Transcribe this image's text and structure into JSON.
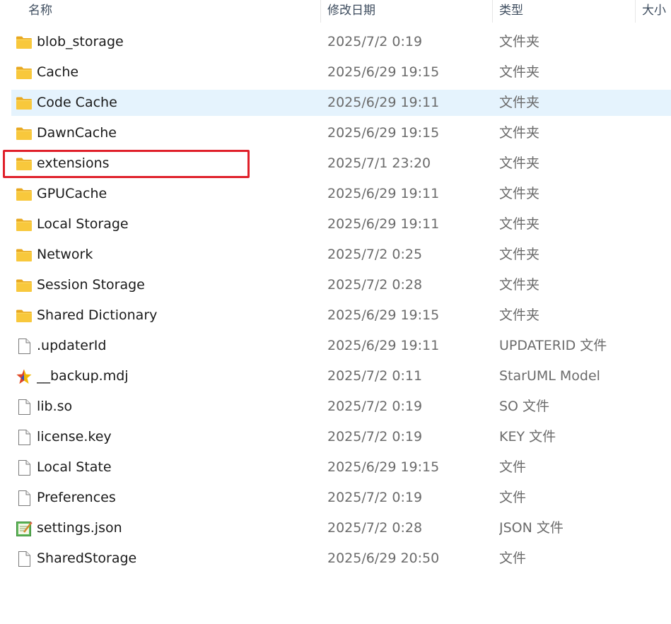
{
  "columns": {
    "name": "名称",
    "date": "修改日期",
    "type": "类型",
    "size": "大小"
  },
  "files": [
    {
      "name": "blob_storage",
      "date": "2025/7/2 0:19",
      "type": "文件夹",
      "icon": "folder-icon"
    },
    {
      "name": "Cache",
      "date": "2025/6/29 19:15",
      "type": "文件夹",
      "icon": "folder-icon"
    },
    {
      "name": "Code Cache",
      "date": "2025/6/29 19:11",
      "type": "文件夹",
      "icon": "folder-icon",
      "hovered": true
    },
    {
      "name": "DawnCache",
      "date": "2025/6/29 19:15",
      "type": "文件夹",
      "icon": "folder-icon"
    },
    {
      "name": "extensions",
      "date": "2025/7/1 23:20",
      "type": "文件夹",
      "icon": "folder-icon",
      "highlighted": true
    },
    {
      "name": "GPUCache",
      "date": "2025/6/29 19:11",
      "type": "文件夹",
      "icon": "folder-icon"
    },
    {
      "name": "Local Storage",
      "date": "2025/6/29 19:11",
      "type": "文件夹",
      "icon": "folder-icon"
    },
    {
      "name": "Network",
      "date": "2025/7/2 0:25",
      "type": "文件夹",
      "icon": "folder-icon"
    },
    {
      "name": "Session Storage",
      "date": "2025/7/2 0:28",
      "type": "文件夹",
      "icon": "folder-icon"
    },
    {
      "name": "Shared Dictionary",
      "date": "2025/6/29 19:15",
      "type": "文件夹",
      "icon": "folder-icon"
    },
    {
      "name": ".updaterId",
      "date": "2025/6/29 19:11",
      "type": "UPDATERID 文件",
      "icon": "file-icon"
    },
    {
      "name": "__backup.mdj",
      "date": "2025/7/2 0:11",
      "type": "StarUML Model",
      "icon": "staruml-icon"
    },
    {
      "name": "lib.so",
      "date": "2025/7/2 0:19",
      "type": "SO 文件",
      "icon": "file-icon"
    },
    {
      "name": "license.key",
      "date": "2025/7/2 0:19",
      "type": "KEY 文件",
      "icon": "file-icon"
    },
    {
      "name": "Local State",
      "date": "2025/6/29 19:15",
      "type": "文件",
      "icon": "file-icon"
    },
    {
      "name": "Preferences",
      "date": "2025/7/2 0:19",
      "type": "文件",
      "icon": "file-icon"
    },
    {
      "name": "settings.json",
      "date": "2025/7/2 0:28",
      "type": "JSON 文件",
      "icon": "json-file-icon"
    },
    {
      "name": "SharedStorage",
      "date": "2025/6/29 20:50",
      "type": "文件",
      "icon": "file-icon"
    }
  ],
  "colors": {
    "hover_row": "#e5f3fd",
    "highlight_border": "#e0202a",
    "folder": "#f8c83c",
    "secondary_text": "#6b6b6b"
  }
}
